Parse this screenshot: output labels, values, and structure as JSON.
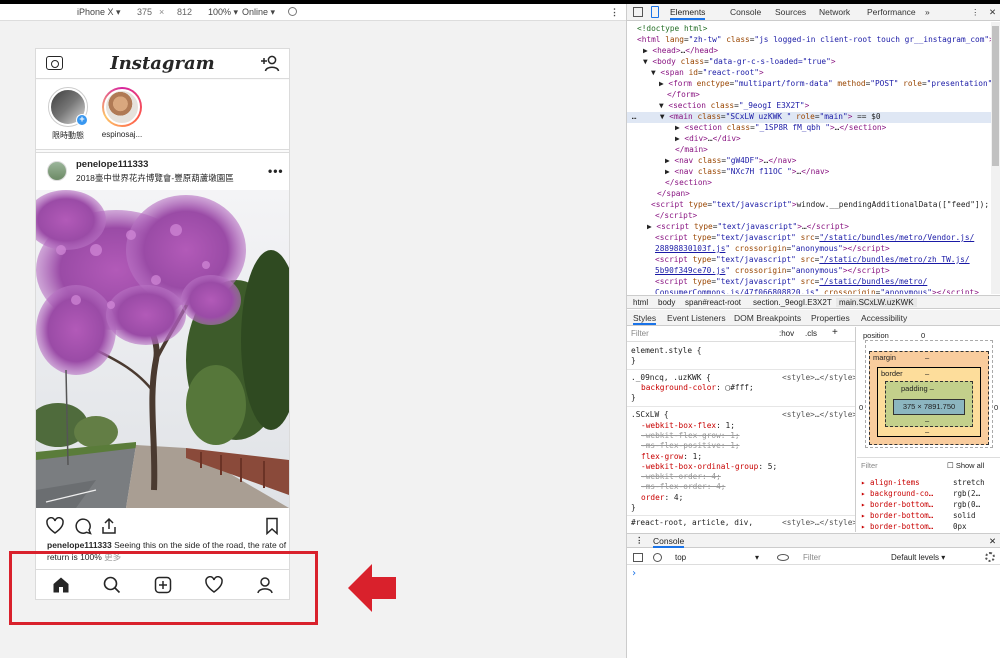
{
  "device_toolbar": {
    "device": "iPhone X ▾",
    "width": "375",
    "times": "×",
    "height": "812",
    "zoom": "100% ▾",
    "network": "Online ▾",
    "more": "⋮"
  },
  "instagram": {
    "logo": "Instagram",
    "stories": [
      {
        "name": "限時動態"
      },
      {
        "name": "espinosaj..."
      }
    ],
    "plus_badge": "+",
    "post": {
      "username": "penelope111333",
      "location": "2018臺中世界花卉博覽會-豐原葫蘆墩園區",
      "more": "•••",
      "caption_user": "penelope111333",
      "caption_text": " Seeing this on the side of the road, the rate of return is 100% ",
      "caption_more": "更多"
    }
  },
  "devtools": {
    "tabs": [
      "Elements",
      "Console",
      "Sources",
      "Network",
      "Performance",
      "»"
    ],
    "menu": "⋮",
    "close": "✕",
    "breadcrumbs": [
      "html",
      "body",
      "span#react-root",
      "section._9eogI.E3X2T",
      "main.SCxLW.uzKWK"
    ],
    "subtabs": [
      "Styles",
      "Event Listeners",
      "DOM Breakpoints",
      "Properties",
      "Accessibility"
    ],
    "filter_placeholder": "Filter",
    "hov": ":hov",
    "cls": ".cls",
    "plus": "+",
    "box_model": {
      "position_label": "position",
      "position_val": "0",
      "margin_label": "margin",
      "border_label": "border",
      "padding_label": "padding –",
      "content": "375 × 7891.750",
      "dash": "–",
      "zero": "0"
    },
    "computed_filter": "Filter",
    "show_all": "Show all",
    "computed": [
      {
        "prop": "▸ align-items",
        "val": "stretch"
      },
      {
        "prop": "▸ background-co…",
        "val": "rgb(2…"
      },
      {
        "prop": "▸ border-bottom…",
        "val": "rgb(0…"
      },
      {
        "prop": "▸ border-bottom…",
        "val": "solid"
      },
      {
        "prop": "▸ border-bottom…",
        "val": "0px"
      }
    ],
    "console_title": "Console",
    "console_context": "top",
    "console_filter": "Filter",
    "console_levels": "Default levels ▾",
    "console_prompt": "›"
  }
}
